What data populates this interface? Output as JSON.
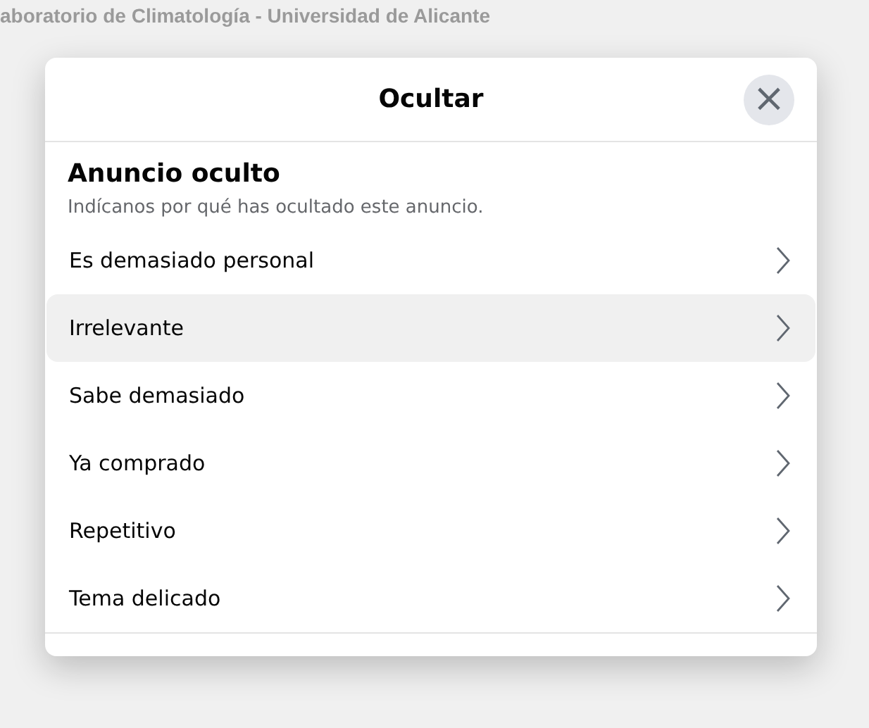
{
  "background": {
    "page_title": "aboratorio de Climatología - Universidad de Alicante"
  },
  "dialog": {
    "title": "Ocultar",
    "close": "×",
    "heading": "Anuncio oculto",
    "description": "Indícanos por qué has ocultado este anuncio.",
    "options": [
      {
        "label": "Es demasiado personal",
        "selected": false
      },
      {
        "label": "Irrelevante",
        "selected": true
      },
      {
        "label": "Sabe demasiado",
        "selected": false
      },
      {
        "label": "Ya comprado",
        "selected": false
      },
      {
        "label": "Repetitivo",
        "selected": false
      },
      {
        "label": "Tema delicado",
        "selected": false
      }
    ]
  }
}
